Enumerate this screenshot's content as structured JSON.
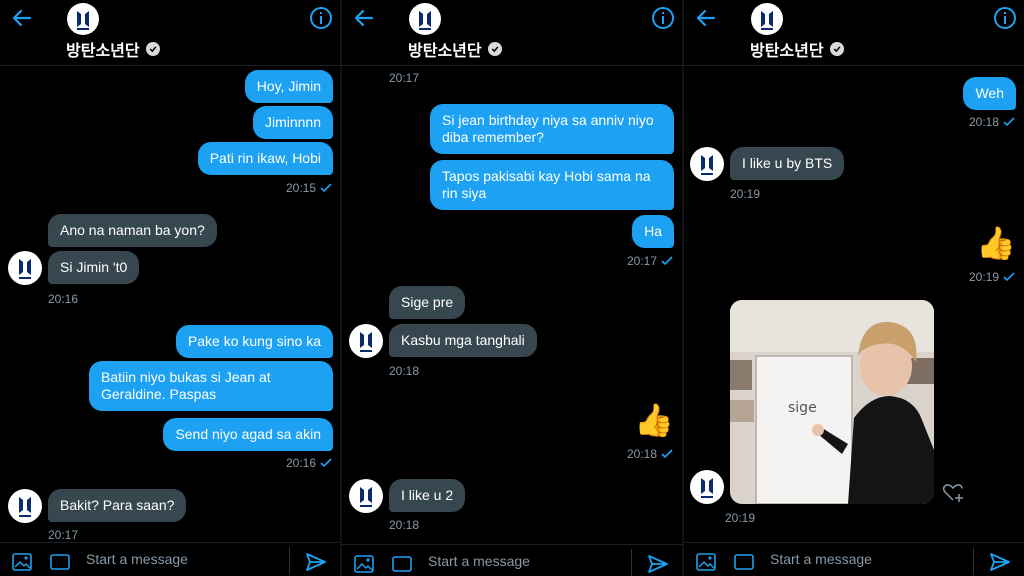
{
  "colors": {
    "accent": "#1da1f2",
    "incoming": "#37474f",
    "background": "#000000",
    "muted": "#8899a6"
  },
  "header": {
    "title": "방탄소년단",
    "back_icon": "arrow-left-icon",
    "info_icon": "info-icon",
    "verified_icon": "verified-badge-icon"
  },
  "composer": {
    "placeholder": "Start a message",
    "image_icon": "image-icon",
    "gif_label": "GIF",
    "send_icon": "send-icon"
  },
  "panel1": {
    "m1": "Hoy, Jimin",
    "m2": "Jiminnnn",
    "m3": "Pati rin ikaw, Hobi",
    "t1": "20:15",
    "m4": "Ano na naman ba yon?",
    "m5": "Si Jimin 't0",
    "t2": "20:16",
    "m6": "Pake ko kung sino ka",
    "m7": "Batiin niyo bukas si Jean at Geraldine. Paspas",
    "m8": "Send niyo agad sa akin",
    "t3": "20:16",
    "m9": "Bakit? Para saan?",
    "t4": "20:17"
  },
  "panel2": {
    "t0": "20:17",
    "m1": "Si jean birthday niya sa anniv niyo diba remember?",
    "m2": "Tapos pakisabi kay Hobi sama na rin siya",
    "m3": "Ha",
    "t1": "20:17",
    "m4": "Sige pre",
    "m5": "Kasbu mga tanghali",
    "t2": "20:18",
    "emoji": "👍",
    "t3": "20:18",
    "m6": "I like u 2",
    "t4": "20:18"
  },
  "panel3": {
    "m1": "Weh",
    "t1": "20:18",
    "m2": "I like u by BTS",
    "t2": "20:19",
    "emoji": "👍",
    "t3": "20:19",
    "photo_text": "sige",
    "t4": "20:19",
    "heart_icon": "heart-add-icon"
  }
}
